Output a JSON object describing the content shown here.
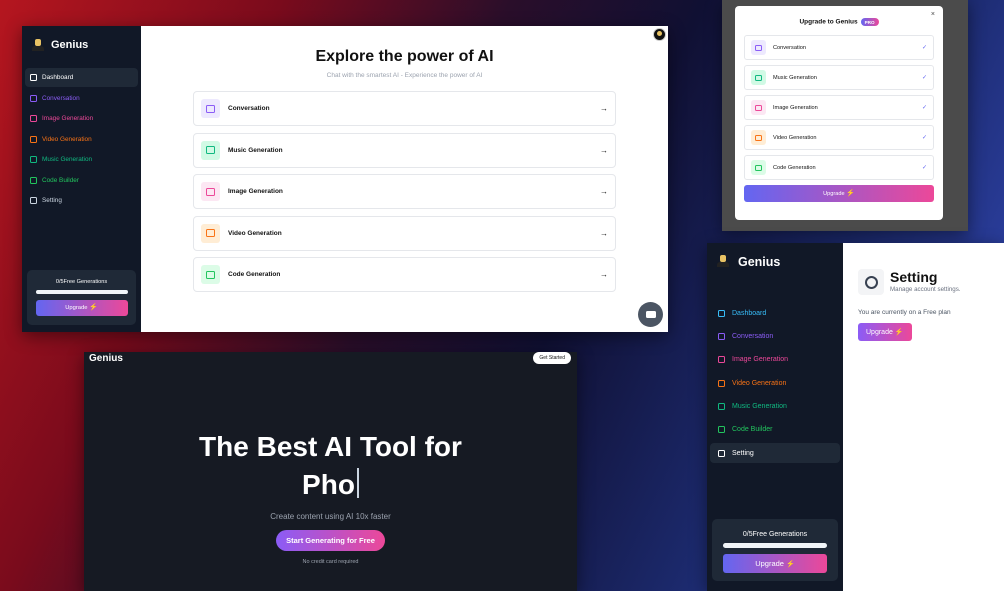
{
  "colors": {
    "accent_start": "#6366f1",
    "accent_end": "#ec4899",
    "sidebar_bg": "#111827"
  },
  "brand": "Genius",
  "dashboard": {
    "nav": [
      {
        "label": "Dashboard",
        "icon": "layout-dashboard-icon",
        "color": "c-sky",
        "active": true
      },
      {
        "label": "Conversation",
        "icon": "message-square-icon",
        "color": "c-vio"
      },
      {
        "label": "Image Generation",
        "icon": "image-icon",
        "color": "c-pink"
      },
      {
        "label": "Video Generation",
        "icon": "video-icon",
        "color": "c-orange"
      },
      {
        "label": "Music Generation",
        "icon": "music-icon",
        "color": "c-emer"
      },
      {
        "label": "Code Builder",
        "icon": "code-icon",
        "color": "c-green"
      },
      {
        "label": "Setting",
        "icon": "settings-icon",
        "color": "c-gray"
      }
    ],
    "free_label": "0/5Free Generations",
    "free_progress": 0,
    "upgrade_label": "Upgrade",
    "title": "Explore the power of AI",
    "subtitle": "Chat with the smartest AI - Experience the power of AI",
    "tools": [
      {
        "label": "Conversation",
        "icon": "message-square-icon",
        "color": "c-vio",
        "bg": "b-vio"
      },
      {
        "label": "Music Generation",
        "icon": "music-icon",
        "color": "c-emer",
        "bg": "b-emer"
      },
      {
        "label": "Image Generation",
        "icon": "image-icon",
        "color": "c-pink",
        "bg": "b-pink"
      },
      {
        "label": "Video Generation",
        "icon": "video-icon",
        "color": "c-orange",
        "bg": "b-orange"
      },
      {
        "label": "Code Generation",
        "icon": "code-icon",
        "color": "c-green",
        "bg": "b-green"
      }
    ]
  },
  "modal": {
    "title": "Upgrade to Genius",
    "badge": "PRO",
    "close": "×",
    "items": [
      {
        "label": "Conversation",
        "icon": "message-square-icon",
        "color": "c-vio",
        "bg": "b-vio"
      },
      {
        "label": "Music Generation",
        "icon": "music-icon",
        "color": "c-emer",
        "bg": "b-emer"
      },
      {
        "label": "Image Generation",
        "icon": "image-icon",
        "color": "c-pink",
        "bg": "b-pink"
      },
      {
        "label": "Video Generation",
        "icon": "video-icon",
        "color": "c-orange",
        "bg": "b-orange"
      },
      {
        "label": "Code Generation",
        "icon": "code-icon",
        "color": "c-green",
        "bg": "b-green"
      }
    ],
    "check": "✓",
    "upgrade_label": "Upgrade"
  },
  "landing": {
    "brand": "Genius",
    "get_started": "Get Started",
    "headline_1": "The Best AI Tool for",
    "headline_2": "Pho",
    "subtext": "Create content using AI 10x faster",
    "cta": "Start Generating for Free",
    "note": "No credit card required"
  },
  "settings": {
    "title": "Setting",
    "description": "Manage account settings.",
    "plan_text": "You are currently on a Free plan",
    "upgrade_label": "Upgrade",
    "active_nav": "Setting"
  },
  "bolt": "⚡",
  "arrow": "→"
}
